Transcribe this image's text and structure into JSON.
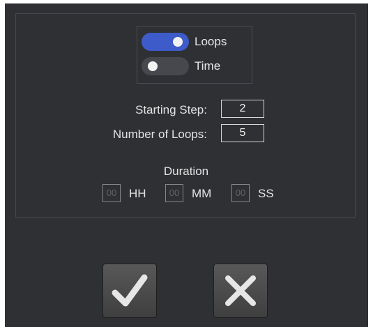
{
  "mode": {
    "loops": {
      "label": "Loops",
      "on": true
    },
    "time": {
      "label": "Time",
      "on": false
    }
  },
  "fields": {
    "starting_step": {
      "label": "Starting Step:",
      "value": "2"
    },
    "number_of_loops": {
      "label": "Number of Loops:",
      "value": "5"
    }
  },
  "duration": {
    "title": "Duration",
    "hours": {
      "value": "00",
      "unit": "HH"
    },
    "minutes": {
      "value": "00",
      "unit": "MM"
    },
    "seconds": {
      "value": "00",
      "unit": "SS"
    }
  },
  "actions": {
    "confirm_icon": "check-icon",
    "cancel_icon": "close-icon"
  },
  "colors": {
    "background": "#2e3033",
    "toggle_on": "#3d5cc9",
    "toggle_off": "#46484d",
    "button": "#4a4a4a"
  }
}
